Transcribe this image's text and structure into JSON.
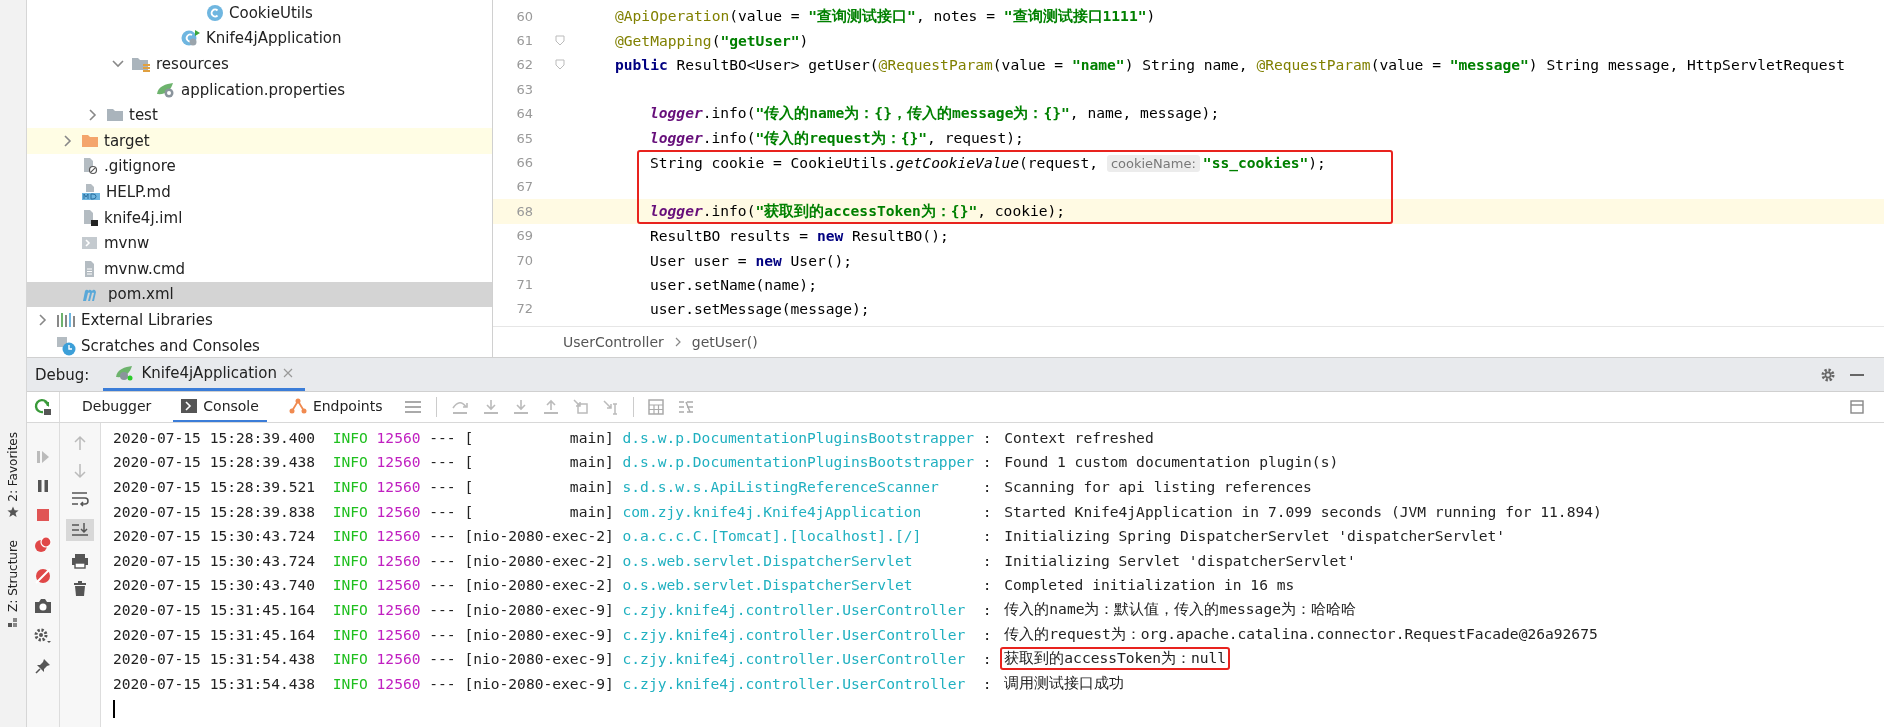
{
  "project_tree": {
    "items": [
      {
        "children": [
          {
            "children": [
              {
                "children": [
                  {
                    "children": [
                      {
                        "children": [
                          {
                            "children": [
                              {
                                "label": "CookieUtils",
                                "kind": "class",
                                "selected": false
                              }
                            ]
                          },
                          {
                            "label": "Knife4jApplication",
                            "kind": "spring-class",
                            "selected": false
                          }
                        ]
                      }
                    ]
                  },
                  {
                    "label": "resources",
                    "kind": "resource-folder",
                    "expanded": true,
                    "selected": false,
                    "children": [
                      {
                        "label": "application.properties",
                        "kind": "spring-properties",
                        "selected": false
                      }
                    ]
                  }
                ]
              },
              {
                "label": "test",
                "kind": "folder",
                "expanded": false,
                "selected": false
              }
            ]
          },
          {
            "label": "target",
            "kind": "excluded-folder",
            "expanded": false,
            "selected": false
          },
          {
            "label": ".gitignore",
            "kind": "ignore-file",
            "selected": false
          },
          {
            "label": "HELP.md",
            "kind": "markdown",
            "selected": false
          },
          {
            "label": "knife4j.iml",
            "kind": "iml",
            "selected": false
          },
          {
            "label": "mvnw",
            "kind": "shell",
            "selected": false
          },
          {
            "label": "mvnw.cmd",
            "kind": "cmd",
            "selected": false
          },
          {
            "label": "pom.xml",
            "kind": "maven",
            "selected": true
          }
        ]
      },
      {
        "label": "External Libraries",
        "kind": "libraries",
        "expanded": false,
        "selected": false
      },
      {
        "label": "Scratches and Consoles",
        "kind": "scratches",
        "selected": false
      }
    ]
  },
  "editor": {
    "lines": [
      {
        "number": "60",
        "in_body": false,
        "boxed": false,
        "current": false,
        "fold": false,
        "tokens": [
          {
            "text": "@ApiOperation",
            "kind": "annotation"
          },
          {
            "text": "(value = ",
            "kind": "plain"
          },
          {
            "text": "\"查询测试接口\"",
            "kind": "string"
          },
          {
            "text": ", notes = ",
            "kind": "plain"
          },
          {
            "text": "\"查询测试接口1111\"",
            "kind": "string"
          },
          {
            "text": ")",
            "kind": "plain"
          }
        ]
      },
      {
        "number": "61",
        "in_body": false,
        "boxed": false,
        "current": false,
        "fold": true,
        "tokens": [
          {
            "text": "@GetMapping",
            "kind": "annotation"
          },
          {
            "text": "(",
            "kind": "plain"
          },
          {
            "text": "\"getUser\"",
            "kind": "string"
          },
          {
            "text": ")",
            "kind": "plain"
          }
        ]
      },
      {
        "number": "62",
        "in_body": false,
        "boxed": false,
        "current": false,
        "fold": true,
        "tokens": [
          {
            "text": "public",
            "kind": "keyword"
          },
          {
            "text": " ResultBO<User> getUser(",
            "kind": "plain"
          },
          {
            "text": "@RequestParam",
            "kind": "annotation"
          },
          {
            "text": "(value = ",
            "kind": "plain"
          },
          {
            "text": "\"name\"",
            "kind": "string"
          },
          {
            "text": ") String name, ",
            "kind": "plain"
          },
          {
            "text": "@RequestParam",
            "kind": "annotation"
          },
          {
            "text": "(value = ",
            "kind": "plain"
          },
          {
            "text": "\"message\"",
            "kind": "string"
          },
          {
            "text": ") String message, HttpServletRequest",
            "kind": "plain"
          }
        ]
      },
      {
        "number": "63",
        "boxed": false,
        "current": false,
        "fold": false
      },
      {
        "number": "64",
        "in_body": true,
        "boxed": false,
        "current": false,
        "fold": false,
        "tokens": [
          {
            "text": "logger",
            "kind": "field"
          },
          {
            "text": ".info(",
            "kind": "plain"
          },
          {
            "text": "\"传入的name为：{}，传入的message为：{}\"",
            "kind": "string"
          },
          {
            "text": ", name, message);",
            "kind": "plain"
          }
        ]
      },
      {
        "number": "65",
        "in_body": true,
        "boxed": false,
        "current": false,
        "fold": false,
        "tokens": [
          {
            "text": "logger",
            "kind": "field"
          },
          {
            "text": ".info(",
            "kind": "plain"
          },
          {
            "text": "\"传入的request为：{}\"",
            "kind": "string"
          },
          {
            "text": ", request);",
            "kind": "plain"
          }
        ]
      },
      {
        "number": "66",
        "in_body": true,
        "boxed": true,
        "current": false,
        "fold": false,
        "tokens": [
          {
            "text": "String cookie = CookieUtils.",
            "kind": "plain"
          },
          {
            "text": "getCookieValue",
            "kind": "static-method"
          },
          {
            "text": "(request, ",
            "kind": "plain"
          },
          {
            "text": "cookieName:",
            "kind": "hint"
          },
          {
            "text": "\"ss_cookies\"",
            "kind": "string"
          },
          {
            "text": ");",
            "kind": "plain"
          }
        ]
      },
      {
        "number": "67",
        "boxed": true,
        "current": false,
        "fold": false
      },
      {
        "number": "68",
        "in_body": true,
        "boxed": true,
        "current": true,
        "fold": false,
        "tokens": [
          {
            "text": "logger",
            "kind": "field"
          },
          {
            "text": ".info(",
            "kind": "plain"
          },
          {
            "text": "\"获取到的accessToken为：{}\"",
            "kind": "string"
          },
          {
            "text": ", cookie);",
            "kind": "plain"
          }
        ]
      },
      {
        "number": "69",
        "in_body": true,
        "boxed": false,
        "current": false,
        "fold": false,
        "tokens": [
          {
            "text": "ResultBO results = ",
            "kind": "plain"
          },
          {
            "text": "new",
            "kind": "keyword"
          },
          {
            "text": " ResultBO();",
            "kind": "plain"
          }
        ]
      },
      {
        "number": "70",
        "in_body": true,
        "boxed": false,
        "current": false,
        "fold": false,
        "tokens": [
          {
            "text": "User user = ",
            "kind": "plain"
          },
          {
            "text": "new",
            "kind": "keyword"
          },
          {
            "text": " User();",
            "kind": "plain"
          }
        ]
      },
      {
        "number": "71",
        "in_body": true,
        "boxed": false,
        "current": false,
        "fold": false,
        "tokens": [
          {
            "text": "user.setName(name);",
            "kind": "plain"
          }
        ]
      },
      {
        "number": "72",
        "in_body": true,
        "boxed": false,
        "current": false,
        "fold": false,
        "tokens": [
          {
            "text": "user.setMessage(message);",
            "kind": "plain"
          }
        ]
      }
    ],
    "breadcrumb": [
      "UserController",
      "getUser()"
    ]
  },
  "debug_panel": {
    "title": "Debug:",
    "tabs": [
      {
        "label": "Knife4jApplication",
        "selected": true
      }
    ],
    "subtabs": [
      {
        "label": "Debugger",
        "selected": false,
        "kind": "debugger"
      },
      {
        "label": "Console",
        "selected": true,
        "kind": "console"
      },
      {
        "label": "Endpoints",
        "selected": false,
        "kind": "endpoints"
      }
    ]
  },
  "side_tabs": [
    {
      "label": "2: Favorites",
      "kind": "favorites"
    },
    {
      "label": "Z: Structure",
      "kind": "structure"
    }
  ],
  "console": {
    "entries": [
      {
        "time": "2020-07-15 15:28:39.400",
        "level": "INFO",
        "pid": "12560",
        "dashes": "---",
        "thread": "[           main]",
        "logger": "d.s.w.p.DocumentationPluginsBootstrapper",
        "colon": ":",
        "message": "Context refreshed",
        "boxed": false
      },
      {
        "time": "2020-07-15 15:28:39.438",
        "level": "INFO",
        "pid": "12560",
        "dashes": "---",
        "thread": "[           main]",
        "logger": "d.s.w.p.DocumentationPluginsBootstrapper",
        "colon": ":",
        "message": "Found 1 custom documentation plugin(s)",
        "boxed": false
      },
      {
        "time": "2020-07-15 15:28:39.521",
        "level": "INFO",
        "pid": "12560",
        "dashes": "---",
        "thread": "[           main]",
        "logger": "s.d.s.w.s.ApiListingReferenceScanner",
        "colon": ":",
        "message": "Scanning for api listing references",
        "boxed": false
      },
      {
        "time": "2020-07-15 15:28:39.838",
        "level": "INFO",
        "pid": "12560",
        "dashes": "---",
        "thread": "[           main]",
        "logger": "com.zjy.knife4j.Knife4jApplication",
        "colon": ":",
        "message": "Started Knife4jApplication in 7.099 seconds (JVM running for 11.894)",
        "boxed": false
      },
      {
        "time": "2020-07-15 15:30:43.724",
        "level": "INFO",
        "pid": "12560",
        "dashes": "---",
        "thread": "[nio-2080-exec-2]",
        "logger": "o.a.c.c.C.[Tomcat].[localhost].[/]",
        "colon": ":",
        "message": "Initializing Spring DispatcherServlet 'dispatcherServlet'",
        "boxed": false
      },
      {
        "time": "2020-07-15 15:30:43.724",
        "level": "INFO",
        "pid": "12560",
        "dashes": "---",
        "thread": "[nio-2080-exec-2]",
        "logger": "o.s.web.servlet.DispatcherServlet",
        "colon": ":",
        "message": "Initializing Servlet 'dispatcherServlet'",
        "boxed": false
      },
      {
        "time": "2020-07-15 15:30:43.740",
        "level": "INFO",
        "pid": "12560",
        "dashes": "---",
        "thread": "[nio-2080-exec-2]",
        "logger": "o.s.web.servlet.DispatcherServlet",
        "colon": ":",
        "message": "Completed initialization in 16 ms",
        "boxed": false
      },
      {
        "time": "2020-07-15 15:31:45.164",
        "level": "INFO",
        "pid": "12560",
        "dashes": "---",
        "thread": "[nio-2080-exec-9]",
        "logger": "c.zjy.knife4j.controller.UserController",
        "colon": ":",
        "message": "传入的name为：默认值，传入的message为：哈哈哈",
        "boxed": false
      },
      {
        "time": "2020-07-15 15:31:45.164",
        "level": "INFO",
        "pid": "12560",
        "dashes": "---",
        "thread": "[nio-2080-exec-9]",
        "logger": "c.zjy.knife4j.controller.UserController",
        "colon": ":",
        "message": "传入的request为：org.apache.catalina.connector.RequestFacade@26a92675",
        "boxed": false
      },
      {
        "time": "2020-07-15 15:31:54.438",
        "level": "INFO",
        "pid": "12560",
        "dashes": "---",
        "thread": "[nio-2080-exec-9]",
        "logger": "c.zjy.knife4j.controller.UserController",
        "colon": ":",
        "message": "获取到的accessToken为：null",
        "boxed": true
      },
      {
        "time": "2020-07-15 15:31:54.438",
        "level": "INFO",
        "pid": "12560",
        "dashes": "---",
        "thread": "[nio-2080-exec-9]",
        "logger": "c.zjy.knife4j.controller.UserController",
        "colon": ":",
        "message": "调用测试接口成功",
        "boxed": false
      }
    ]
  }
}
